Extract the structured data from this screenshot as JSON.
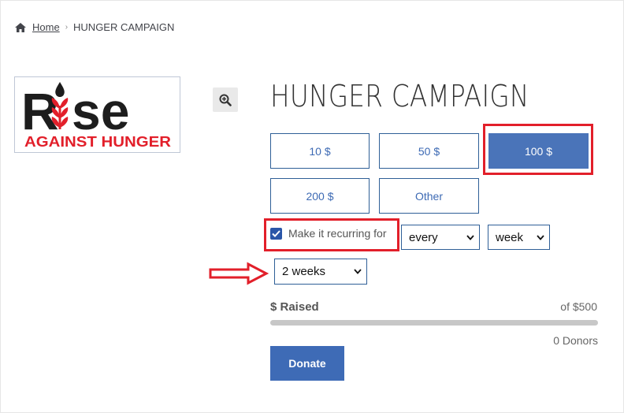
{
  "breadcrumb": {
    "home_label": "Home",
    "current": "HUNGER CAMPAIGN",
    "home_icon": "home-icon"
  },
  "logo": {
    "text_main": "Rise",
    "text_sub": "AGAINST HUNGER",
    "brand_red": "#e21f2a",
    "brand_dark": "#1d1d1d"
  },
  "product": {
    "title": "HUNGER CAMPAIGN",
    "zoom_icon": "zoom-in-icon"
  },
  "amounts": {
    "a10": "10 $",
    "a50": "50 $",
    "a100": "100 $",
    "a200": "200 $",
    "other": "Other",
    "selected": "100 $"
  },
  "recurring": {
    "checked": true,
    "label": "Make it recurring for",
    "frequency": "every",
    "unit": "week",
    "duration": "2 weeks"
  },
  "raised": {
    "label": "$ Raised",
    "goal": "of $500",
    "progress_percent": 0,
    "donors": "0 Donors"
  },
  "donate_label": "Donate",
  "colors": {
    "accent": "#4a74b9",
    "highlight": "#e21f2a",
    "border": "#2f5f97"
  }
}
